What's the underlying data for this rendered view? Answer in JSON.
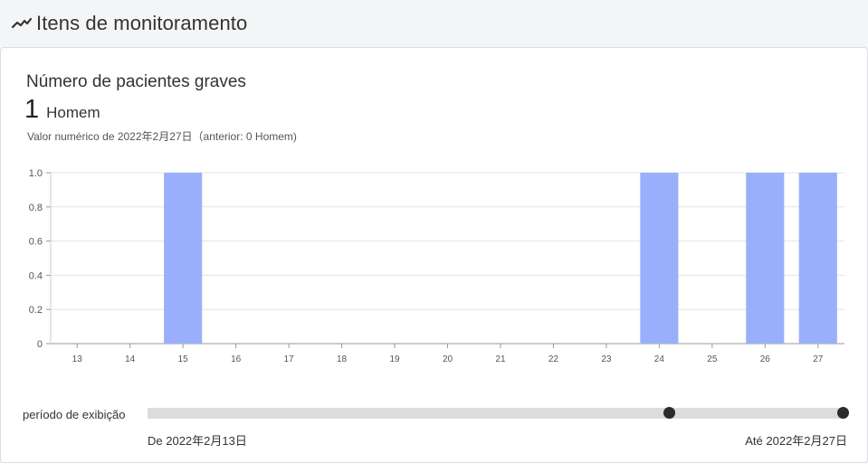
{
  "header": {
    "title": "Itens de monitoramento",
    "icon": "trend-line-icon"
  },
  "card": {
    "title": "Número de pacientes graves",
    "value": "1",
    "unit": "Homem",
    "note": "Valor numérico de 2022年2月27日（anterior: 0 Homem)"
  },
  "chart_data": {
    "type": "bar",
    "title": "",
    "xlabel": "",
    "ylabel": "",
    "categories": [
      "13",
      "14",
      "15",
      "16",
      "17",
      "18",
      "19",
      "20",
      "21",
      "22",
      "23",
      "24",
      "25",
      "26",
      "27"
    ],
    "values": [
      0,
      0,
      1,
      0,
      0,
      0,
      0,
      0,
      0,
      0,
      0,
      1,
      0,
      1,
      1
    ],
    "ylim": [
      0,
      1
    ],
    "yticks": [
      "0",
      "0.2",
      "0.4",
      "0.6",
      "0.8",
      "1.0"
    ],
    "grid": true,
    "bar_color": "#9aaffb"
  },
  "range": {
    "label": "período de exibição",
    "from": "De 2022年2月13日",
    "to": "Até 2022年2月27日",
    "handle_start_fraction": 0.75,
    "handle_end_fraction": 1.0
  }
}
